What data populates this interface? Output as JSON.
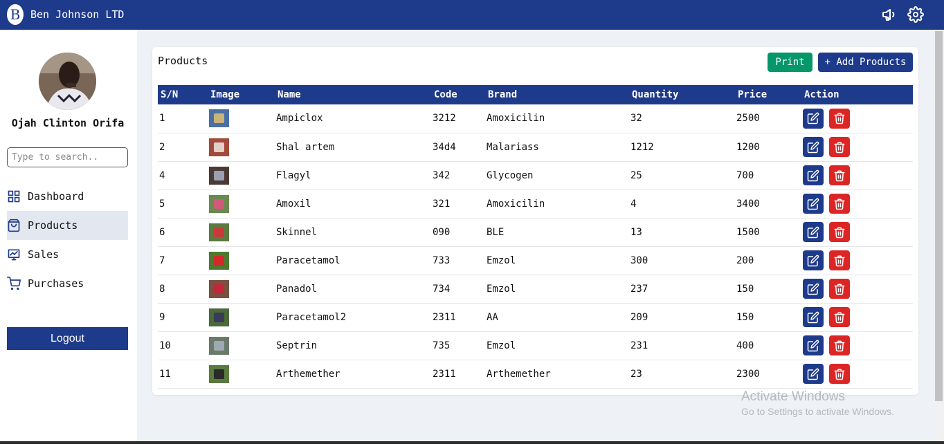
{
  "app": {
    "logo_letter": "B",
    "title": "Ben Johnson LTD"
  },
  "sidebar": {
    "username": "Ojah Clinton Orifa",
    "search_placeholder": "Type to search..",
    "items": [
      {
        "label": "Dashboard",
        "icon": "grid-icon"
      },
      {
        "label": "Products",
        "icon": "bag-icon",
        "active": true
      },
      {
        "label": "Sales",
        "icon": "chart-icon"
      },
      {
        "label": "Purchases",
        "icon": "cart-icon"
      }
    ],
    "logout_label": "Logout"
  },
  "products": {
    "title": "Products",
    "print_label": "Print",
    "add_label": "+ Add Products",
    "columns": [
      "S/N",
      "Image",
      "Name",
      "Code",
      "Brand",
      "Quantity",
      "Price",
      "Action"
    ],
    "rows": [
      {
        "sn": "1",
        "name": "Ampiclox",
        "code": "3212",
        "brand": "Amoxicilin",
        "quantity": "32",
        "price": "2500"
      },
      {
        "sn": "2",
        "name": "Shal artem",
        "code": "34d4",
        "brand": "Malariass",
        "quantity": "1212",
        "price": "1200"
      },
      {
        "sn": "4",
        "name": "Flagyl",
        "code": "342",
        "brand": "Glycogen",
        "quantity": "25",
        "price": "700"
      },
      {
        "sn": "5",
        "name": "Amoxil",
        "code": "321",
        "brand": "Amoxicilin",
        "quantity": "4",
        "price": "3400"
      },
      {
        "sn": "6",
        "name": "Skinnel",
        "code": "090",
        "brand": "BLE",
        "quantity": "13",
        "price": "1500"
      },
      {
        "sn": "7",
        "name": "Paracetamol",
        "code": "733",
        "brand": "Emzol",
        "quantity": "300",
        "price": "200"
      },
      {
        "sn": "8",
        "name": "Panadol",
        "code": "734",
        "brand": "Emzol",
        "quantity": "237",
        "price": "150"
      },
      {
        "sn": "9",
        "name": "Paracetamol2",
        "code": "2311",
        "brand": "AA",
        "quantity": "209",
        "price": "150"
      },
      {
        "sn": "10",
        "name": "Septrin",
        "code": "735",
        "brand": "Emzol",
        "quantity": "231",
        "price": "400"
      },
      {
        "sn": "11",
        "name": "Arthemether",
        "code": "2311",
        "brand": "Arthemether",
        "quantity": "23",
        "price": "2300"
      }
    ]
  },
  "watermark": {
    "line1": "Activate Windows",
    "line2": "Go to Settings to activate Windows."
  },
  "colors": {
    "primary": "#1e3a8a",
    "success": "#059669",
    "danger": "#dc2626"
  }
}
